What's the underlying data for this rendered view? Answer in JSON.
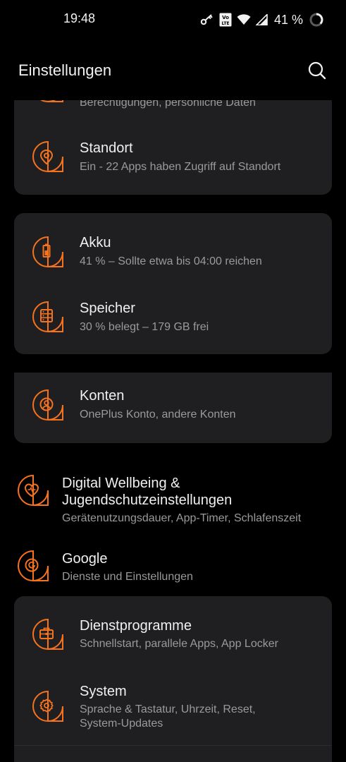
{
  "status_bar": {
    "time": "19:48",
    "battery_percent_text": "41 %",
    "icons": [
      "key-icon",
      "volte-icon",
      "wifi-icon",
      "cell-signal-icon",
      "battery-ring-icon"
    ]
  },
  "app_bar": {
    "title": "Einstellungen",
    "search_icon": "search-icon"
  },
  "colors": {
    "accent": "#f5731f",
    "background": "#000000",
    "card": "#1f1f21",
    "title_text": "#f0f0f0",
    "subtitle_text": "#9a9a9a"
  },
  "items": {
    "privacy": {
      "subtitle": "Berechtigungen, persönliche Daten",
      "icon": "privacy-icon"
    },
    "location": {
      "title": "Standort",
      "subtitle": "Ein - 22 Apps haben Zugriff auf Standort",
      "icon": "location-pin-icon"
    },
    "battery": {
      "title": "Akku",
      "subtitle": "41 % – Sollte etwa bis 04:00 reichen",
      "icon": "battery-icon"
    },
    "storage": {
      "title": "Speicher",
      "subtitle": "30 % belegt – 179 GB frei",
      "icon": "storage-icon"
    },
    "accounts": {
      "title": "Konten",
      "subtitle": "OnePlus Konto, andere Konten",
      "icon": "account-icon"
    },
    "wellbeing": {
      "title_line1": "Digital Wellbeing &",
      "title_line2": "Jugendschutzeinstellungen",
      "subtitle": "Gerätenutzungsdauer, App-Timer, Schlafenszeit",
      "icon": "heart-icon"
    },
    "google": {
      "title": "Google",
      "subtitle": "Dienste und Einstellungen",
      "icon": "google-icon"
    },
    "utilities": {
      "title": "Dienstprogramme",
      "subtitle": "Schnellstart, parallele Apps, App Locker",
      "icon": "toolbox-icon"
    },
    "system": {
      "title": "System",
      "subtitle_line1": "Sprache & Tastatur, Uhrzeit, Reset,",
      "subtitle_line2": "System-Updates",
      "icon": "gear-icon"
    }
  }
}
